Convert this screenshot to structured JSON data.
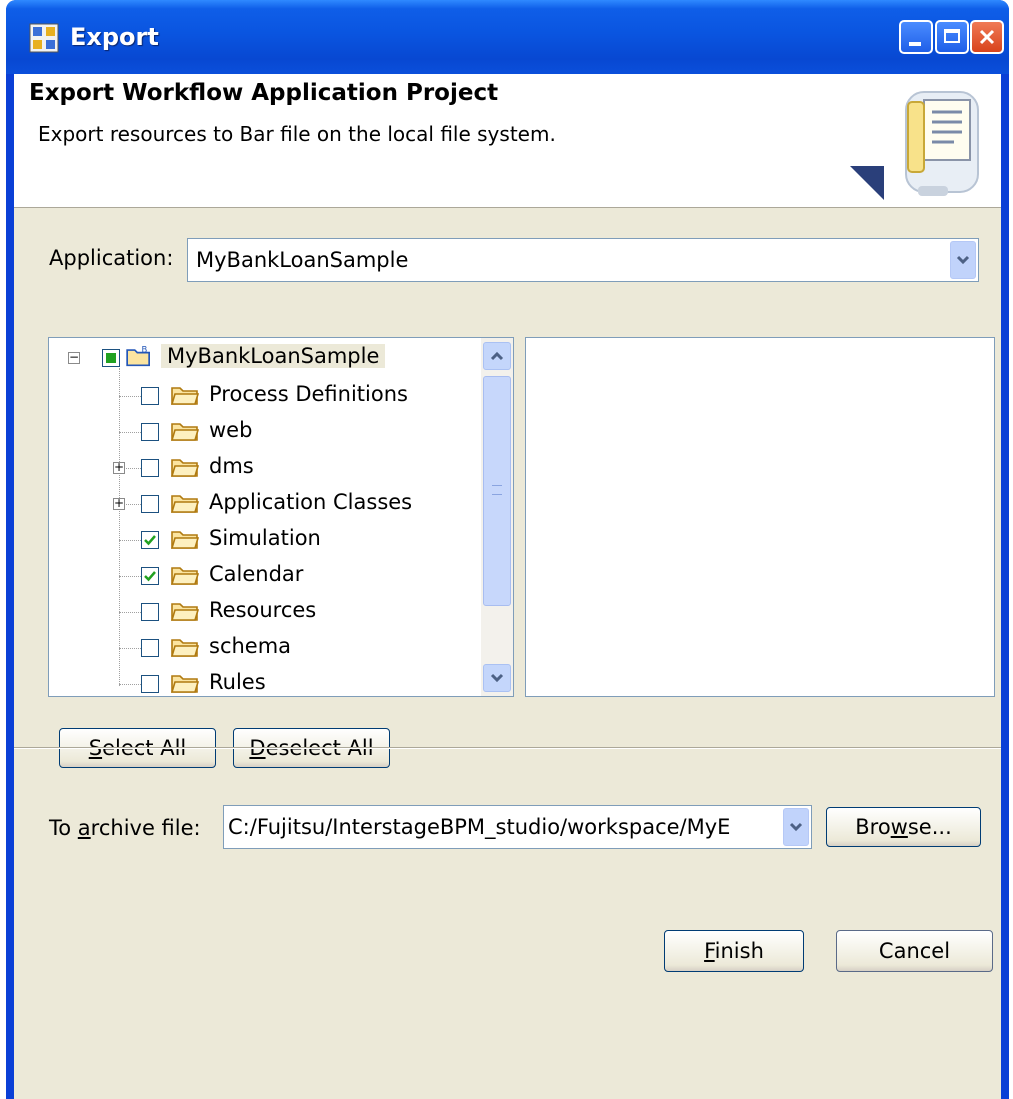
{
  "window": {
    "title": "Export"
  },
  "header": {
    "title": "Export Workflow Application Project",
    "description": "Export resources to Bar file on the local file system."
  },
  "application": {
    "label": "Application:",
    "value": "MyBankLoanSample"
  },
  "tree": {
    "root": {
      "label": "MyBankLoanSample",
      "state": "partial",
      "expanded": true
    },
    "items": [
      {
        "label": "Process Definitions",
        "checked": false,
        "expandable": false
      },
      {
        "label": "web",
        "checked": false,
        "expandable": false
      },
      {
        "label": "dms",
        "checked": false,
        "expandable": true
      },
      {
        "label": "Application Classes",
        "checked": false,
        "expandable": true
      },
      {
        "label": "Simulation",
        "checked": true,
        "expandable": false
      },
      {
        "label": "Calendar",
        "checked": true,
        "expandable": false
      },
      {
        "label": "Resources",
        "checked": false,
        "expandable": false
      },
      {
        "label": "schema",
        "checked": false,
        "expandable": false
      },
      {
        "label": "Rules",
        "checked": false,
        "expandable": false
      }
    ]
  },
  "buttons": {
    "select_all_mnemonic": "S",
    "select_all_rest": "elect All",
    "deselect_all_mnemonic": "D",
    "deselect_all_rest": "eselect All",
    "browse_mnemonic": "w",
    "browse_pre": "Bro",
    "browse_rest": "se...",
    "finish_mnemonic": "F",
    "finish_rest": "inish",
    "cancel": "Cancel"
  },
  "archive": {
    "label_pre": "To ",
    "label_mnemonic": "a",
    "label_rest": "rchive file:",
    "value": "C:/Fujitsu/InterstageBPM_studio/workspace/MyE"
  },
  "colors": {
    "titlebar": "#0a55e0",
    "dialog_bg": "#ece9d8",
    "check": "#21a121"
  }
}
